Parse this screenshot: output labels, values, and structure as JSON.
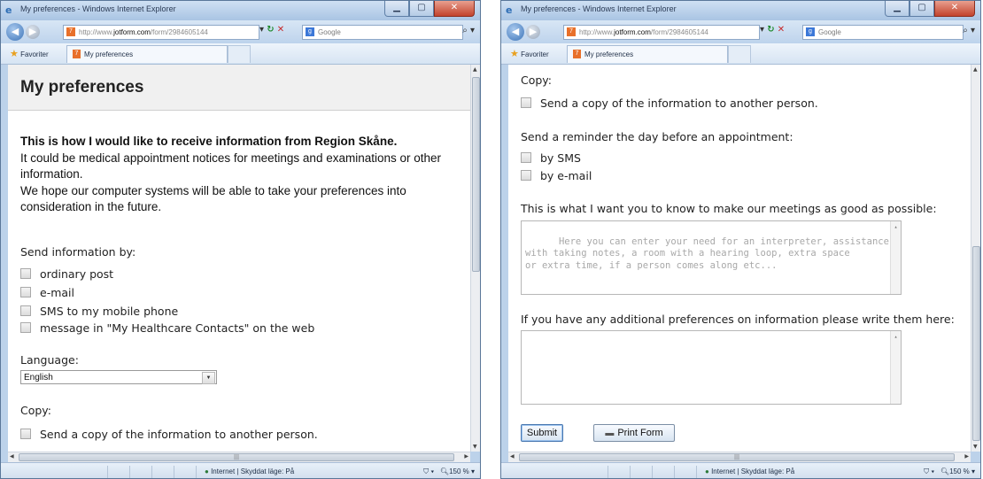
{
  "browser": {
    "title": "My preferences - Windows Internet Explorer",
    "url_prefix": "http://www.",
    "url_domain": "jotform.com",
    "url_path": "/form/2984605144",
    "search_placeholder": "Google",
    "favorites_label": "Favoriter",
    "tab_label": "My preferences",
    "status_zone": "Internet | Skyddat läge: På",
    "zoom": "150 %"
  },
  "form": {
    "title": "My preferences",
    "intro_heading": "This is how I would like to receive information from Region Skåne.",
    "intro_line1": "It could be medical appointment notices for meetings and examinations or other information.",
    "intro_line2": "We hope our computer systems will be able to take your preferences into consideration in the future.",
    "send_label": "Send information by:",
    "send_options": [
      "ordinary post",
      "e-mail",
      "SMS to my mobile phone",
      "message in \"My Healthcare Contacts\" on the web"
    ],
    "language_label": "Language:",
    "language_value": "English",
    "copy_label": "Copy:",
    "copy_option": "Send a copy of the information to another person.",
    "reminder_label": "Send a reminder the day before an appointment:",
    "reminder_options": [
      "by SMS",
      "by e-mail"
    ],
    "meetings_label": "This is what I want you to know to make our meetings as good as possible:",
    "meetings_placeholder": "Here you can enter your need for an interpreter, assistance\nwith taking notes, a room with a hearing loop, extra space\nor extra time, if a person comes along etc...",
    "additional_label": "If you have any additional preferences on information please write them here:",
    "submit_label": "Submit",
    "print_label": "Print Form"
  },
  "colors": {
    "window_frame": "#bcd2ea",
    "close_button": "#c2432d",
    "header_bg": "#f0f0f0"
  },
  "icons": [
    "ie-icon",
    "back-arrow-icon",
    "forward-arrow-icon",
    "refresh-icon",
    "stop-icon",
    "search-icon",
    "favorites-star-icon",
    "globe-icon",
    "zoom-icon",
    "printer-icon"
  ]
}
